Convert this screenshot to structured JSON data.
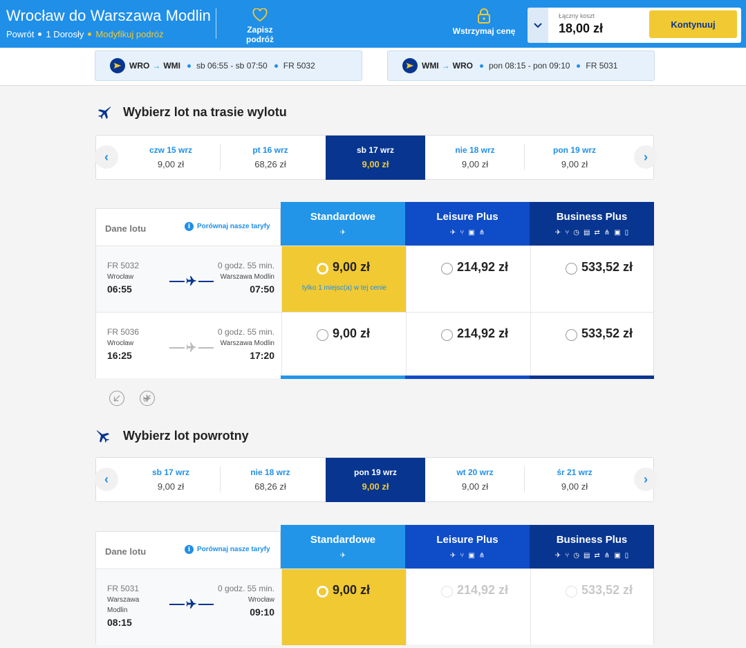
{
  "header": {
    "title": "Wrocław do Warszawa Modlin",
    "trip_type": "Powrót",
    "passengers": "1 Dorosły",
    "modify": "Modyfikuj podróż",
    "save_trip": "Zapisz podróż",
    "hold_price": "Wstrzymaj cenę",
    "total_label": "Łączny koszt",
    "total_value": "18,00 zł",
    "continue": "Kontynuuj"
  },
  "colors": {
    "brand_blue": "#1f8fe8",
    "navy": "#073590",
    "yellow": "#f1c933",
    "standard": "#2295e8",
    "leisure": "#0f4cc7",
    "business": "#073590"
  },
  "summary": [
    {
      "from": "WRO",
      "to": "WMI",
      "times": "sb 06:55 - sb 07:50",
      "flight": "FR 5032"
    },
    {
      "from": "WMI",
      "to": "WRO",
      "times": "pon 08:15 - pon 09:10",
      "flight": "FR 5031"
    }
  ],
  "outbound": {
    "title": "Wybierz lot na trasie wylotu",
    "dates": [
      {
        "day": "czw 15 wrz",
        "price": "9,00 zł"
      },
      {
        "day": "pt 16 wrz",
        "price": "68,26 zł"
      },
      {
        "day": "sb 17 wrz",
        "price": "9,00 zł"
      },
      {
        "day": "nie 18 wrz",
        "price": "9,00 zł"
      },
      {
        "day": "pon 19 wrz",
        "price": "9,00 zł"
      }
    ],
    "flights": [
      {
        "number": "FR 5032",
        "duration": "0 godz. 55 min.",
        "from": "Wrocław",
        "to": "Warszawa Modlin",
        "dep": "06:55",
        "arr": "07:50",
        "std": "9,00 zł",
        "note": "tylko 1 miejsc(a) w tej cenie",
        "leisure": "214,92 zł",
        "business": "533,52 zł"
      },
      {
        "number": "FR 5036",
        "duration": "0 godz. 55 min.",
        "from": "Wrocław",
        "to": "Warszawa Modlin",
        "dep": "16:25",
        "arr": "17:20",
        "std": "9,00 zł",
        "note": "",
        "leisure": "214,92 zł",
        "business": "533,52 zł"
      }
    ]
  },
  "return": {
    "title": "Wybierz lot powrotny",
    "dates": [
      {
        "day": "sb 17 wrz",
        "price": "9,00 zł"
      },
      {
        "day": "nie 18 wrz",
        "price": "68,26 zł"
      },
      {
        "day": "pon 19 wrz",
        "price": "9,00 zł"
      },
      {
        "day": "wt 20 wrz",
        "price": "9,00 zł"
      },
      {
        "day": "śr 21 wrz",
        "price": "9,00 zł"
      }
    ],
    "flights": [
      {
        "number": "FR 5031",
        "duration": "0 godz. 55 min.",
        "from": "Warszawa Modlin",
        "to": "Wrocław",
        "dep": "08:15",
        "arr": "09:10",
        "std": "9,00 zł",
        "note": "",
        "leisure": "214,92 zł",
        "business": "533,52 zł"
      }
    ]
  },
  "table": {
    "info_label": "Dane lotu",
    "compare": "Porównaj nasze taryfy",
    "tiers": {
      "standard": "Standardowe",
      "leisure": "Leisure Plus",
      "business": "Business Plus"
    }
  }
}
